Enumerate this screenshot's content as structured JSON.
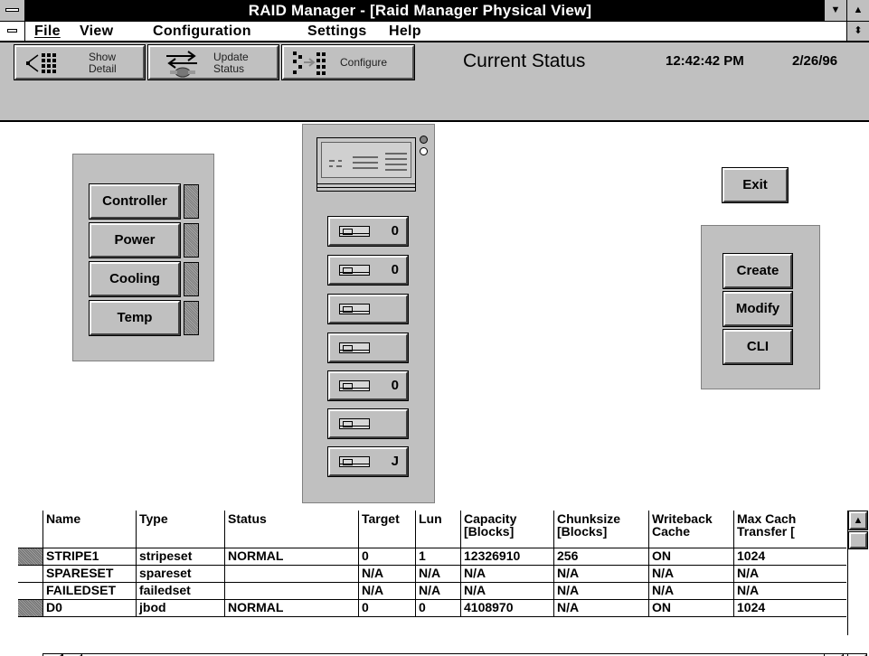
{
  "window": {
    "title": "RAID Manager  - [Raid Manager Physical View]",
    "minimize_glyph": "▼",
    "maximize_glyph": "▲",
    "restore_glyph": "⬍"
  },
  "menu": [
    {
      "label": "File"
    },
    {
      "label": "View"
    },
    {
      "label": "Configuration"
    },
    {
      "label": "Settings"
    },
    {
      "label": "Help"
    }
  ],
  "toolbar": {
    "show_detail": {
      "line1": "Show",
      "line2": "Detail",
      "icon": "show-detail-icon"
    },
    "update_status": {
      "line1": "Update",
      "line2": "Status",
      "icon": "update-status-icon"
    },
    "configure": {
      "label": "Configure",
      "icon": "configure-icon"
    },
    "status_title": "Current Status",
    "time": "12:42:42 PM",
    "date": "2/26/96"
  },
  "subsystem_panel": {
    "buttons": [
      "Controller",
      "Power",
      "Cooling",
      "Temp"
    ]
  },
  "cabinet": {
    "drives": [
      {
        "lun": "0"
      },
      {
        "lun": "0"
      },
      {
        "lun": ""
      },
      {
        "lun": ""
      },
      {
        "lun": "0"
      },
      {
        "lun": ""
      },
      {
        "lun": "J"
      }
    ]
  },
  "exit_button": {
    "label": "Exit"
  },
  "config_panel": {
    "buttons": [
      "Create",
      "Modify",
      "CLI"
    ]
  },
  "table": {
    "headers": [
      "Name",
      "Type",
      "Status",
      "Target",
      "Lun",
      "Capacity [Blocks]",
      "Chunksize [Blocks]",
      "Writeback Cache",
      "Max Cach Transfer ["
    ],
    "rows": [
      {
        "selected": true,
        "cells": [
          "STRIPE1",
          "stripeset",
          "NORMAL",
          "0",
          "1",
          "12326910",
          "256",
          "ON",
          "1024"
        ]
      },
      {
        "selected": false,
        "cells": [
          "SPARESET",
          "spareset",
          "",
          "N/A",
          "N/A",
          "N/A",
          "N/A",
          "N/A",
          "N/A"
        ]
      },
      {
        "selected": false,
        "cells": [
          "FAILEDSET",
          "failedset",
          "",
          "N/A",
          "N/A",
          "N/A",
          "N/A",
          "N/A",
          "N/A"
        ]
      },
      {
        "selected": true,
        "cells": [
          "D0",
          "jbod",
          "NORMAL",
          "0",
          "0",
          "4108970",
          "N/A",
          "ON",
          "1024"
        ]
      }
    ]
  }
}
